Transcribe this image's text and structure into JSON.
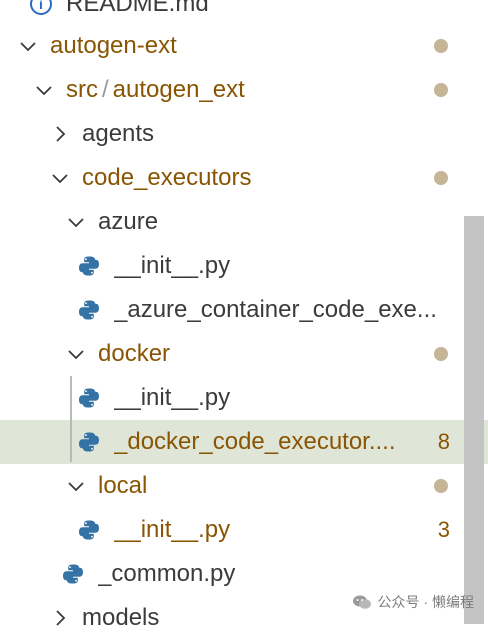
{
  "explorer": {
    "items": [
      {
        "label": "README.md"
      },
      {
        "label": "autogen-ext"
      },
      {
        "label_a": "src",
        "separator": "/",
        "label_b": "autogen_ext"
      },
      {
        "label": "agents"
      },
      {
        "label": "code_executors"
      },
      {
        "label": "azure"
      },
      {
        "label": "__init__.py"
      },
      {
        "label": "_azure_container_code_exe..."
      },
      {
        "label": "docker"
      },
      {
        "label": "__init__.py"
      },
      {
        "label": "_docker_code_executor....",
        "badge": "8"
      },
      {
        "label": "local"
      },
      {
        "label": "__init__.py",
        "badge": "3"
      },
      {
        "label": "_common.py"
      },
      {
        "label": "models"
      }
    ]
  },
  "watermark": {
    "text": "公众号 · 懒编程"
  },
  "colors": {
    "modified": "#895503",
    "selection": "#dfe6d8",
    "modified_dot": "#c5b596",
    "python_blue": "#3572a5",
    "python_yellow": "#ffd43b"
  }
}
